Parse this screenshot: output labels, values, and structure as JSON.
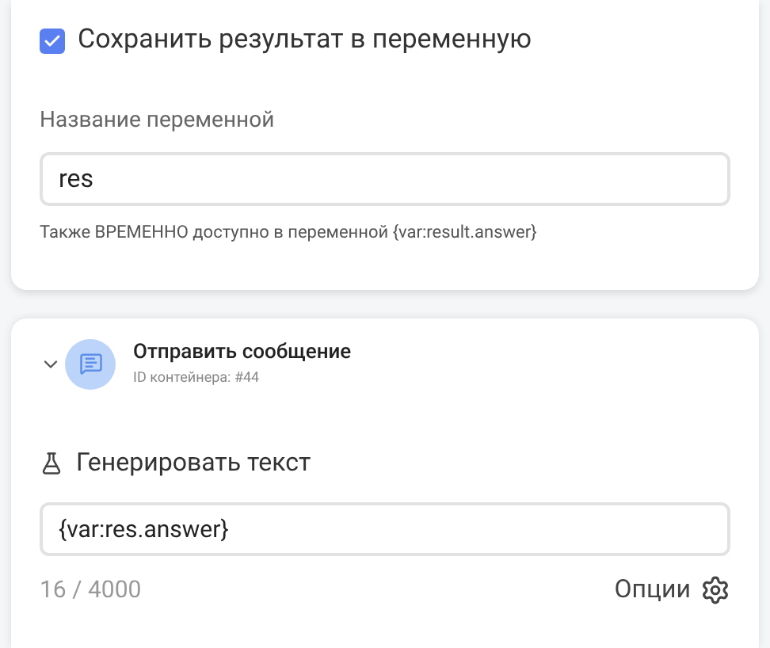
{
  "save_card": {
    "save_checkbox": {
      "label": "Сохранить результат в переменную",
      "checked": true
    },
    "variable_name": {
      "label": "Название переменной",
      "value": "res"
    },
    "hint": "Также ВРЕМЕННО доступно в переменной {var:result.answer}"
  },
  "message_card": {
    "expanded": true,
    "title": "Отправить сообщение",
    "container_id": "ID контейнера: #44",
    "generate_label": "Генерировать текст",
    "text_field": {
      "value": "{var:res.answer}"
    },
    "char_count": "16 / 4000",
    "options_button": "Опции"
  }
}
